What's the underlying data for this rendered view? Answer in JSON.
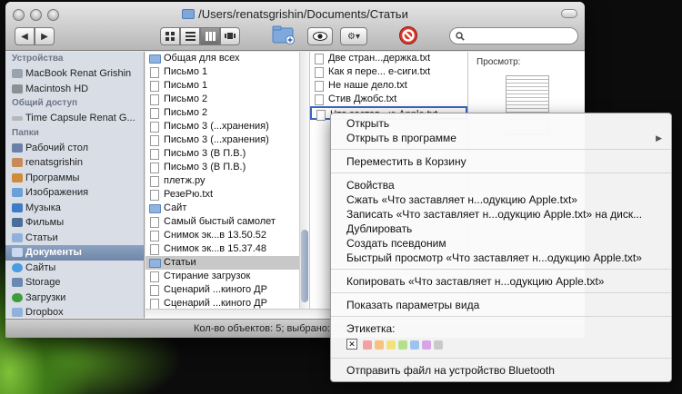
{
  "window": {
    "title": "/Users/renatsgrishin/Documents/Статьи"
  },
  "toolbar": {
    "nav_back": "◀",
    "nav_fwd": "▶",
    "view_icon": "icon-view",
    "view_list": "list-view",
    "view_columns": "column-view",
    "view_coverflow": "coverflow-view",
    "action_label": "⚙▾",
    "search_placeholder": ""
  },
  "sidebar": {
    "devices_header": "Устройства",
    "devices": [
      {
        "label": "MacBook Renat Grishin",
        "icon": "laptop-icon"
      },
      {
        "label": "Macintosh HD",
        "icon": "harddisk-icon"
      }
    ],
    "shared_header": "Общий доступ",
    "shared": [
      {
        "label": "Time Capsule Renat G...",
        "icon": "network-drive-icon"
      }
    ],
    "places_header": "Папки",
    "places": [
      {
        "label": "Рабочий стол",
        "icon": "desktop-folder-icon",
        "color": "#6b7fa8"
      },
      {
        "label": "renatsgrishin",
        "icon": "home-icon",
        "color": "#c98a5a"
      },
      {
        "label": "Программы",
        "icon": "applications-icon",
        "color": "#d08a3a"
      },
      {
        "label": "Изображения",
        "icon": "pictures-icon",
        "color": "#6aa0d8"
      },
      {
        "label": "Музыка",
        "icon": "music-icon",
        "color": "#3e7cc9"
      },
      {
        "label": "Фильмы",
        "icon": "movies-icon",
        "color": "#4a6e9a"
      },
      {
        "label": "Статьи",
        "icon": "folder-icon",
        "color": "#8fb1db"
      },
      {
        "label": "Документы",
        "icon": "documents-icon",
        "color": "#8fb1db"
      },
      {
        "label": "Сайты",
        "icon": "sites-icon",
        "color": "#4a9be0"
      },
      {
        "label": "Storage",
        "icon": "storage-icon",
        "color": "#6a88b0"
      },
      {
        "label": "Загрузки",
        "icon": "downloads-icon",
        "color": "#3e9c3e"
      },
      {
        "label": "Dropbox",
        "icon": "dropbox-icon",
        "color": "#8fb1db"
      }
    ]
  },
  "column1": {
    "items": [
      {
        "label": "Общая для всех",
        "kind": "dir"
      },
      {
        "label": "Письмо 1",
        "kind": "file"
      },
      {
        "label": "Письмо 1",
        "kind": "file"
      },
      {
        "label": "Письмо 2",
        "kind": "file"
      },
      {
        "label": "Письмо 2",
        "kind": "file"
      },
      {
        "label": "Письмо 3 (...хранения)",
        "kind": "file"
      },
      {
        "label": "Письмо 3 (...хранения)",
        "kind": "file"
      },
      {
        "label": "Письмо 3 (В П.В.)",
        "kind": "file"
      },
      {
        "label": "Письмо 3 (В П.В.)",
        "kind": "file"
      },
      {
        "label": "плетж.ру",
        "kind": "file"
      },
      {
        "label": "РезеРю.txt",
        "kind": "file"
      },
      {
        "label": "Сайт",
        "kind": "dir"
      },
      {
        "label": "Самый быстый самолет",
        "kind": "file"
      },
      {
        "label": "Снимок эк...в 13.50.52",
        "kind": "file"
      },
      {
        "label": "Снимок эк...в 15.37.48",
        "kind": "file"
      },
      {
        "label": "Статьи",
        "kind": "dir",
        "selected": true
      },
      {
        "label": "Стирание загрузок",
        "kind": "file"
      },
      {
        "label": "Сценарий ...киного ДР",
        "kind": "file"
      },
      {
        "label": "Сценарий ...киного ДР",
        "kind": "file"
      }
    ]
  },
  "column2": {
    "items": [
      {
        "label": "Две стран...держка.txt"
      },
      {
        "label": "Как я пере... е-сиги.txt"
      },
      {
        "label": "Не наше дело.txt"
      },
      {
        "label": "Стив Джобс.txt"
      },
      {
        "label": "Что застав...ю Apple.txt",
        "selected": true
      }
    ]
  },
  "preview": {
    "label": "Просмотр:"
  },
  "status": {
    "text": "Кол-во объектов: 5; выбрано: 1; д"
  },
  "context_menu": {
    "open": "Открыть",
    "open_with": "Открыть в программе",
    "move_to_trash": "Переместить в Корзину",
    "get_info": "Свойства",
    "compress": "Сжать «Что заставляет н...одукцию Apple.txt»",
    "burn": "Записать «Что заставляет н...одукцию Apple.txt» на диск...",
    "duplicate": "Дублировать",
    "make_alias": "Создать псевдоним",
    "quick_look": "Быстрый просмотр «Что заставляет н...одукцию Apple.txt»",
    "copy": "Копировать «Что заставляет н...одукцию Apple.txt»",
    "show_view_options": "Показать параметры вида",
    "label_title": "Этикетка:",
    "label_none": "✕",
    "label_colors": [
      "#f2a0a0",
      "#f6c27d",
      "#f3e27a",
      "#b5e08a",
      "#9dc3f0",
      "#d7a4e8",
      "#c9c9c9"
    ],
    "send_bluetooth": "Отправить файл на устройство Bluetooth"
  }
}
